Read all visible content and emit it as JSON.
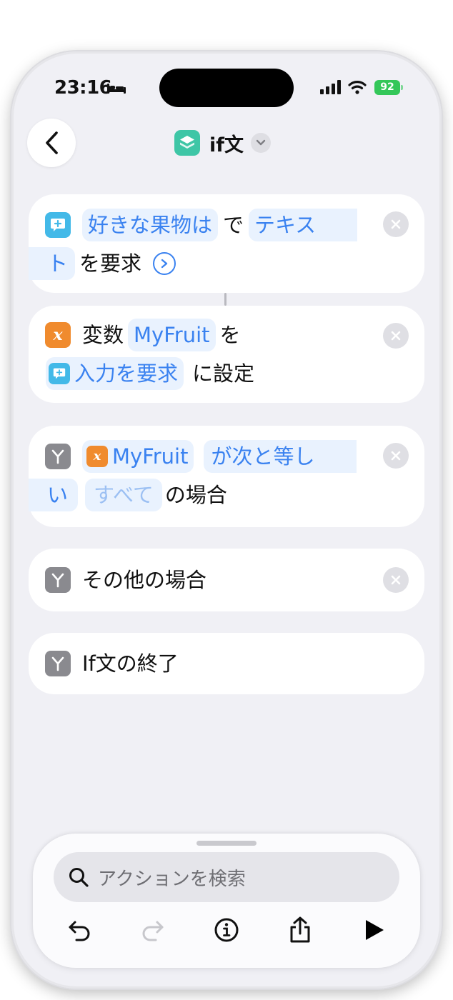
{
  "status_bar": {
    "time": "23:16",
    "battery": "92"
  },
  "nav": {
    "title": "if文"
  },
  "actions": [
    {
      "icon": "message-plus-icon",
      "line1": [
        "好きな果物は",
        "で",
        "テキス"
      ],
      "line2": [
        "ト",
        "を要求"
      ]
    },
    {
      "icon": "variable-icon",
      "line1": [
        "変数",
        "MyFruit",
        "を"
      ],
      "line2": [
        "入力を要求",
        "に設定"
      ]
    },
    {
      "icon": "if-branch-icon",
      "line1": [
        "MyFruit",
        "が次と等し"
      ],
      "line2": [
        "い",
        "すべて",
        "の場合"
      ]
    },
    {
      "icon": "if-branch-icon",
      "label": "その他の場合"
    },
    {
      "icon": "if-branch-icon",
      "label": "If文の終了"
    }
  ],
  "search": {
    "placeholder": "アクションを検索"
  },
  "colors": {
    "accent": "#3a82f0",
    "pill_bg": "#e9f2fe",
    "background": "#f0f0f5",
    "variable": "#f08b2e",
    "ask_input": "#43b9e8",
    "control": "#8a8a8f"
  }
}
